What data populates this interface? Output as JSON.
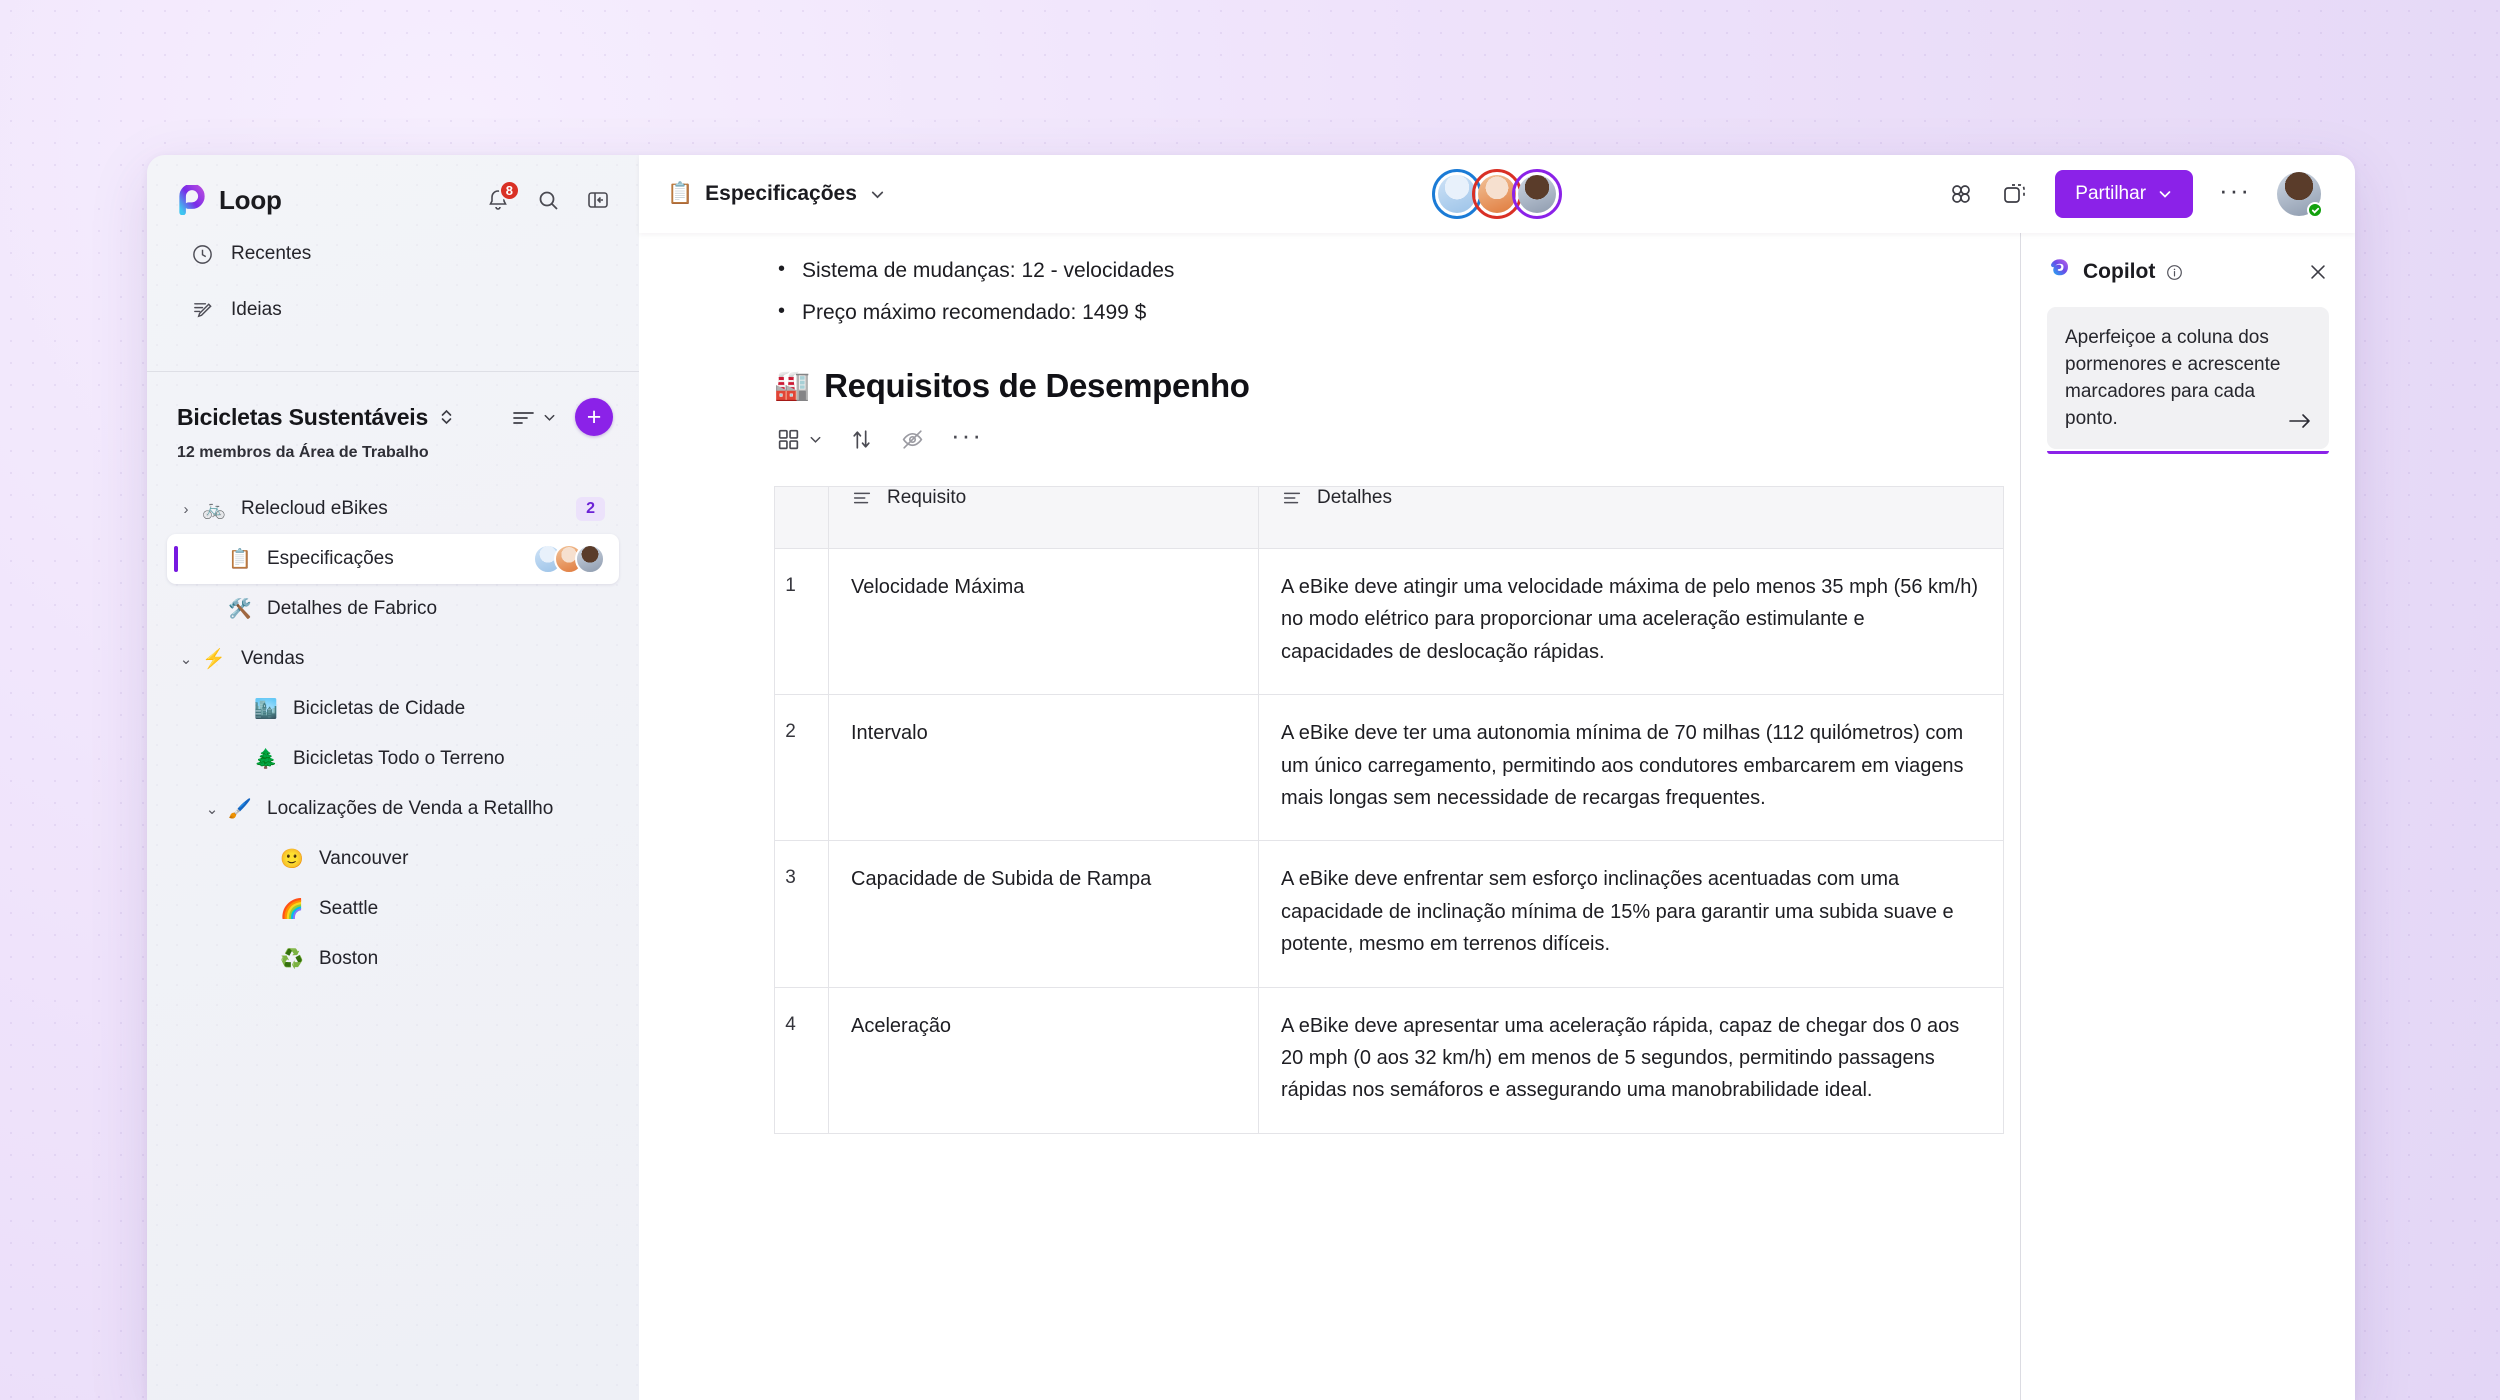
{
  "brand": {
    "name": "Loop",
    "logo_icon": "loop-logo-icon"
  },
  "sidebar": {
    "notifications_count": "8",
    "search_icon": "search-icon",
    "collapse_icon": "collapse-panel-icon",
    "nav": [
      {
        "label": "Recentes",
        "icon": "clock-icon"
      },
      {
        "label": "Ideias",
        "icon": "pencil-note-icon"
      }
    ],
    "workspace": {
      "title": "Bicicletas Sustentáveis",
      "subtitle": "12 membros da Área de Trabalho",
      "sort_icon": "sort-lines-icon",
      "add_label": "+",
      "switch_icon": "chevron-up-down-icon"
    },
    "tree": [
      {
        "label": "Relecloud eBikes",
        "emoji": "🚲",
        "chevron": "›",
        "badge": "2",
        "indent": 0,
        "selected": false
      },
      {
        "label": "Especificações",
        "emoji": "📋",
        "chevron": "",
        "avatars": 3,
        "indent": 1,
        "selected": true
      },
      {
        "label": "Detalhes de Fabrico",
        "emoji": "🛠️",
        "chevron": "",
        "indent": 1,
        "selected": false
      },
      {
        "label": "Vendas",
        "emoji": "⚡",
        "chevron": "⌄",
        "indent": 0,
        "selected": false
      },
      {
        "label": "Bicicletas de Cidade",
        "emoji": "🏙️",
        "chevron": "",
        "indent": 2,
        "selected": false
      },
      {
        "label": "Bicicletas Todo o Terreno",
        "emoji": "🌲",
        "chevron": "",
        "indent": 2,
        "selected": false
      },
      {
        "label": "Localizações de Venda a Retallho",
        "emoji": "🖌️",
        "chevron": "⌄",
        "indent": 1,
        "selected": false
      },
      {
        "label": "Vancouver",
        "emoji": "🙂",
        "chevron": "",
        "indent": 3,
        "selected": false
      },
      {
        "label": "Seattle",
        "emoji": "🌈",
        "chevron": "",
        "indent": 3,
        "selected": false
      },
      {
        "label": "Boston",
        "emoji": "♻️",
        "chevron": "",
        "indent": 3,
        "selected": false
      }
    ]
  },
  "topbar": {
    "doc_emoji": "📋",
    "doc_name": "Especificações",
    "doc_chevron_icon": "chevron-down-icon",
    "apps_icon": "apps-clover-icon",
    "copy_icon": "duplicate-dashed-icon",
    "share_label": "Partilhar",
    "share_chevron_icon": "chevron-down-icon",
    "more_label": "···",
    "presence_rings": [
      "#1b7bd6",
      "#d93025",
      "#8b22e8"
    ]
  },
  "document": {
    "bullets": [
      "Sistema de mudanças: 12 - velocidades",
      "Preço máximo recomendado: 1499 $"
    ],
    "heading_emoji": "🏭",
    "heading": "Requisitos de Desempenho",
    "table_toolbar": {
      "view_icon": "grid-view-icon",
      "view_chevron_icon": "chevron-down-icon",
      "sort_icon": "sort-arrows-icon",
      "hide_icon": "eye-hidden-icon",
      "more_icon": "ellipsis-icon"
    },
    "table": {
      "columns": [
        {
          "label": "",
          "icon": ""
        },
        {
          "label": "Requisito",
          "icon": "text-lines-icon"
        },
        {
          "label": "Detalhes",
          "icon": "text-lines-icon"
        }
      ],
      "rows": [
        {
          "num": "1",
          "requisito": "Velocidade Máxima",
          "detalhes": "A eBike deve atingir uma velocidade máxima de pelo menos 35 mph (56 km/h) no modo elétrico para proporcionar uma aceleração estimulante e capacidades de deslocação rápidas."
        },
        {
          "num": "2",
          "requisito": "Intervalo",
          "detalhes": "A eBike deve ter uma autonomia mínima de 70 milhas (112 quilómetros) com um único carregamento, permitindo aos condutores embarcarem em viagens mais longas sem necessidade de recargas frequentes."
        },
        {
          "num": "3",
          "requisito": "Capacidade de Subida de Rampa",
          "detalhes": "A eBike deve enfrentar sem esforço inclinações acentuadas com uma capacidade de inclinação mínima de 15% para garantir uma subida suave e potente, mesmo em terrenos difíceis."
        },
        {
          "num": "4",
          "requisito": "Aceleração",
          "detalhes": "A eBike deve apresentar uma aceleração rápida, capaz de chegar dos 0 aos 20 mph (0 aos 32 km/h) em menos de 5 segundos, permitindo passagens rápidas nos semáforos e assegurando uma manobrabilidade ideal."
        }
      ]
    }
  },
  "copilot": {
    "title": "Copilot",
    "logo_icon": "copilot-icon",
    "info_icon": "info-icon",
    "close_icon": "close-icon",
    "suggestion": "Aperfeiçoe a coluna dos pormenores e acrescente marcadores para cada ponto.",
    "submit_icon": "arrow-right-icon",
    "accent": "#8b22e8"
  }
}
